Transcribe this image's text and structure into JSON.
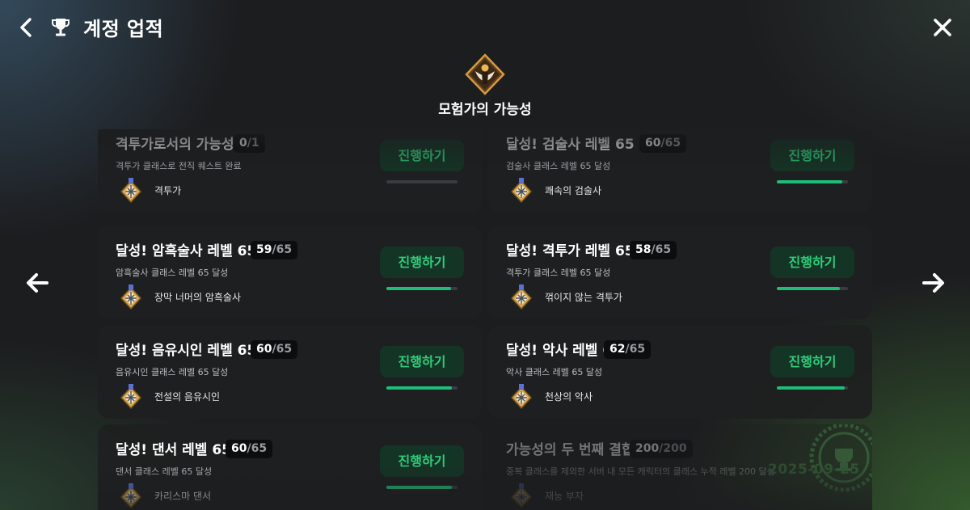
{
  "header": {
    "title": "계정 업적"
  },
  "category": {
    "title": "모험가의 가능성"
  },
  "achievements": [
    {
      "title": "격투가로서의 가능성",
      "current": "0",
      "total": "/1",
      "desc": "격투가 클래스로 전직 퀘스트 완료",
      "reward": "격투가",
      "button": "진행하기",
      "progress": 0.0
    },
    {
      "title": "달성! 검술사 레벨 65",
      "current": "60",
      "total": "/65",
      "desc": "검술사 클래스 레벨 65 달성",
      "reward": "쾌속의 검술사",
      "button": "진행하기",
      "progress": 0.923
    },
    {
      "title": "달성! 암흑술사 레벨 65",
      "current": "59",
      "total": "/65",
      "desc": "암흑술사 클래스 레벨 65 달성",
      "reward": "장막 너머의 암흑술사",
      "button": "진행하기",
      "progress": 0.908
    },
    {
      "title": "달성! 격투가 레벨 65",
      "current": "58",
      "total": "/65",
      "desc": "격투가 클래스 레벨 65 달성",
      "reward": "꺾이지 않는 격투가",
      "button": "진행하기",
      "progress": 0.892
    },
    {
      "title": "달성! 음유시인 레벨 65",
      "current": "60",
      "total": "/65",
      "desc": "음유시인 클래스 레벨 65 달성",
      "reward": "전설의 음유시인",
      "button": "진행하기",
      "progress": 0.923
    },
    {
      "title": "달성! 악사 레벨 65",
      "current": "62",
      "total": "/65",
      "desc": "악사 클래스 레벨 65 달성",
      "reward": "천상의 악사",
      "button": "진행하기",
      "progress": 0.954
    },
    {
      "title": "달성! 댄서 레벨 65",
      "current": "60",
      "total": "/65",
      "desc": "댄서 클래스 레벨 65 달성",
      "reward": "카리스마 댄서",
      "button": "진행하기",
      "progress": 0.923
    },
    {
      "title": "가능성의 두 번째 결합",
      "current": "200",
      "total": "/200",
      "desc": "중복 클래스를 제외한 서버 내 모든 캐릭터의 클래스 누적 레벨 200 달성",
      "reward": "재능 부자",
      "completed": true,
      "completed_date": "2025-09-25"
    }
  ],
  "colors": {
    "accent": "#2ad07a",
    "bar_fill": "#1fbe78",
    "button_bg": "#143526"
  },
  "icons": {
    "back": "chevron-left-icon",
    "trophy": "trophy-icon",
    "close": "close-icon",
    "prev": "arrow-left-icon",
    "next": "arrow-right-icon",
    "emblem": "winged-emblem-icon",
    "reward": "title-badge-icon"
  }
}
